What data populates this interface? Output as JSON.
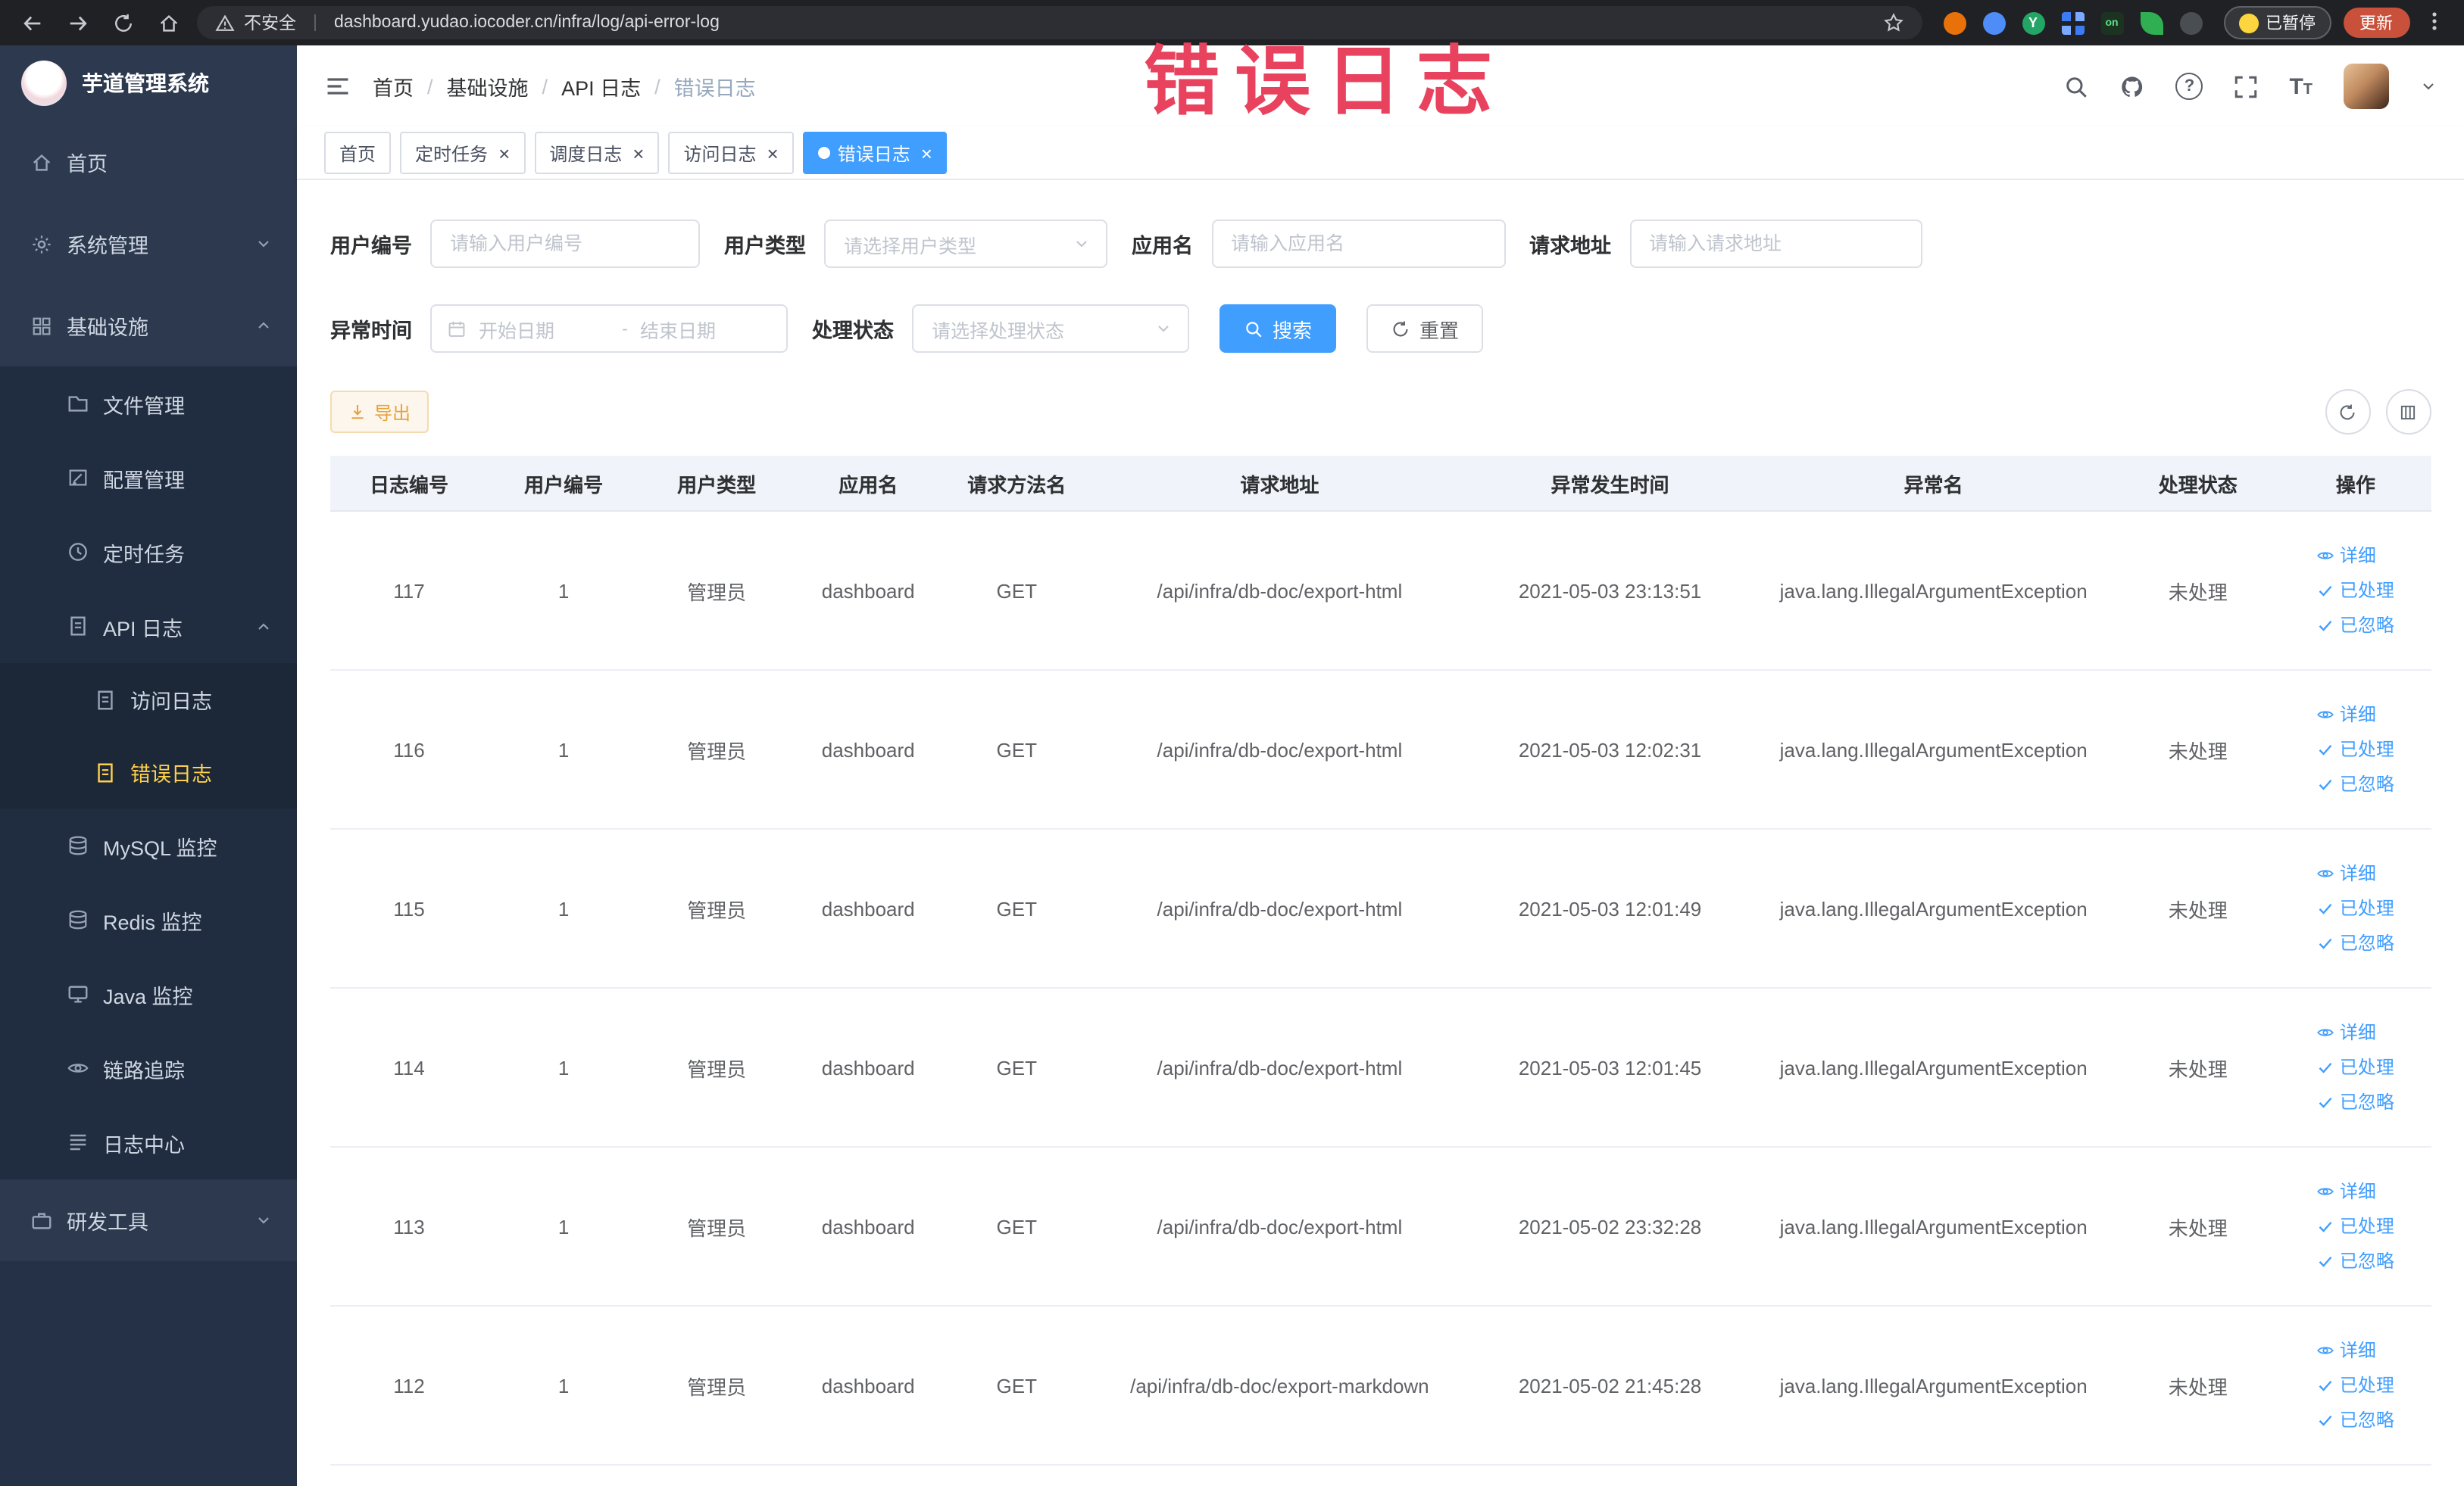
{
  "browser": {
    "security_label": "不安全",
    "url": "dashboard.yudao.iocoder.cn/infra/log/api-error-log",
    "ext_on_label": "on",
    "ext_green_label": "Y",
    "paused_badge": "已暂停",
    "update_label": "更新"
  },
  "watermark": "错误日志",
  "colors": {
    "primary": "#409eff",
    "sidebar_bg": "#2c394e",
    "active_menu": "#ffd04b",
    "watermark": "#e8425e",
    "export_warning": "#e6a23c"
  },
  "sidebar": {
    "logo_title": "芋道管理系统",
    "items": [
      {
        "icon": "i-home",
        "label": "首页",
        "level": "top"
      },
      {
        "icon": "i-gear",
        "label": "系统管理",
        "level": "top",
        "chevron": "down"
      },
      {
        "icon": "i-grid",
        "label": "基础设施",
        "level": "top",
        "chevron": "up"
      },
      {
        "icon": "i-folder",
        "label": "文件管理",
        "level": "sub"
      },
      {
        "icon": "i-edit",
        "label": "配置管理",
        "level": "sub"
      },
      {
        "icon": "i-clock",
        "label": "定时任务",
        "level": "sub"
      },
      {
        "icon": "i-doc",
        "label": "API 日志",
        "level": "sub",
        "chevron": "up"
      },
      {
        "icon": "i-doc",
        "label": "访问日志",
        "level": "sub2"
      },
      {
        "icon": "i-doc",
        "label": "错误日志",
        "level": "sub2",
        "active": true
      },
      {
        "icon": "i-db",
        "label": "MySQL 监控",
        "level": "sub"
      },
      {
        "icon": "i-db",
        "label": "Redis 监控",
        "level": "sub"
      },
      {
        "icon": "i-monitor",
        "label": "Java 监控",
        "level": "sub"
      },
      {
        "icon": "i-eye",
        "label": "链路追踪",
        "level": "sub"
      },
      {
        "icon": "i-stack",
        "label": "日志中心",
        "level": "sub"
      },
      {
        "icon": "i-tool",
        "label": "研发工具",
        "level": "top",
        "chevron": "down"
      }
    ]
  },
  "breadcrumb": [
    "首页",
    "基础设施",
    "API 日志",
    "错误日志"
  ],
  "tabs": [
    {
      "label": "首页"
    },
    {
      "label": "定时任务",
      "closable": true
    },
    {
      "label": "调度日志",
      "closable": true
    },
    {
      "label": "访问日志",
      "closable": true
    },
    {
      "label": "错误日志",
      "closable": true,
      "active": true
    }
  ],
  "filters": {
    "user_id": {
      "label": "用户编号",
      "placeholder": "请输入用户编号"
    },
    "user_type": {
      "label": "用户类型",
      "placeholder": "请选择用户类型"
    },
    "app_name": {
      "label": "应用名",
      "placeholder": "请输入应用名"
    },
    "request_url": {
      "label": "请求地址",
      "placeholder": "请输入请求地址"
    },
    "exception_time": {
      "label": "异常时间",
      "start_placeholder": "开始日期",
      "separator": "-",
      "end_placeholder": "结束日期"
    },
    "process_status": {
      "label": "处理状态",
      "placeholder": "请选择处理状态"
    },
    "search_label": "搜索",
    "reset_label": "重置"
  },
  "toolbar": {
    "export_label": "导出"
  },
  "table": {
    "columns": [
      "日志编号",
      "用户编号",
      "用户类型",
      "应用名",
      "请求方法名",
      "请求地址",
      "异常发生时间",
      "异常名",
      "处理状态",
      "操作"
    ],
    "actions": [
      {
        "icon": "i-eye",
        "label": "详细"
      },
      {
        "icon": "i-check",
        "label": "已处理"
      },
      {
        "icon": "i-check",
        "label": "已忽略"
      }
    ],
    "rows": [
      {
        "id": "117",
        "user_id": "1",
        "user_type": "管理员",
        "app_name": "dashboard",
        "method": "GET",
        "url": "/api/infra/db-doc/export-html",
        "time": "2021-05-03 23:13:51",
        "exception": "java.lang.IllegalArgumentException",
        "status": "未处理"
      },
      {
        "id": "116",
        "user_id": "1",
        "user_type": "管理员",
        "app_name": "dashboard",
        "method": "GET",
        "url": "/api/infra/db-doc/export-html",
        "time": "2021-05-03 12:02:31",
        "exception": "java.lang.IllegalArgumentException",
        "status": "未处理"
      },
      {
        "id": "115",
        "user_id": "1",
        "user_type": "管理员",
        "app_name": "dashboard",
        "method": "GET",
        "url": "/api/infra/db-doc/export-html",
        "time": "2021-05-03 12:01:49",
        "exception": "java.lang.IllegalArgumentException",
        "status": "未处理"
      },
      {
        "id": "114",
        "user_id": "1",
        "user_type": "管理员",
        "app_name": "dashboard",
        "method": "GET",
        "url": "/api/infra/db-doc/export-html",
        "time": "2021-05-03 12:01:45",
        "exception": "java.lang.IllegalArgumentException",
        "status": "未处理"
      },
      {
        "id": "113",
        "user_id": "1",
        "user_type": "管理员",
        "app_name": "dashboard",
        "method": "GET",
        "url": "/api/infra/db-doc/export-html",
        "time": "2021-05-02 23:32:28",
        "exception": "java.lang.IllegalArgumentException",
        "status": "未处理"
      },
      {
        "id": "112",
        "user_id": "1",
        "user_type": "管理员",
        "app_name": "dashboard",
        "method": "GET",
        "url": "/api/infra/db-doc/export-markdown",
        "time": "2021-05-02 21:45:28",
        "exception": "java.lang.IllegalArgumentException",
        "status": "未处理"
      }
    ]
  }
}
